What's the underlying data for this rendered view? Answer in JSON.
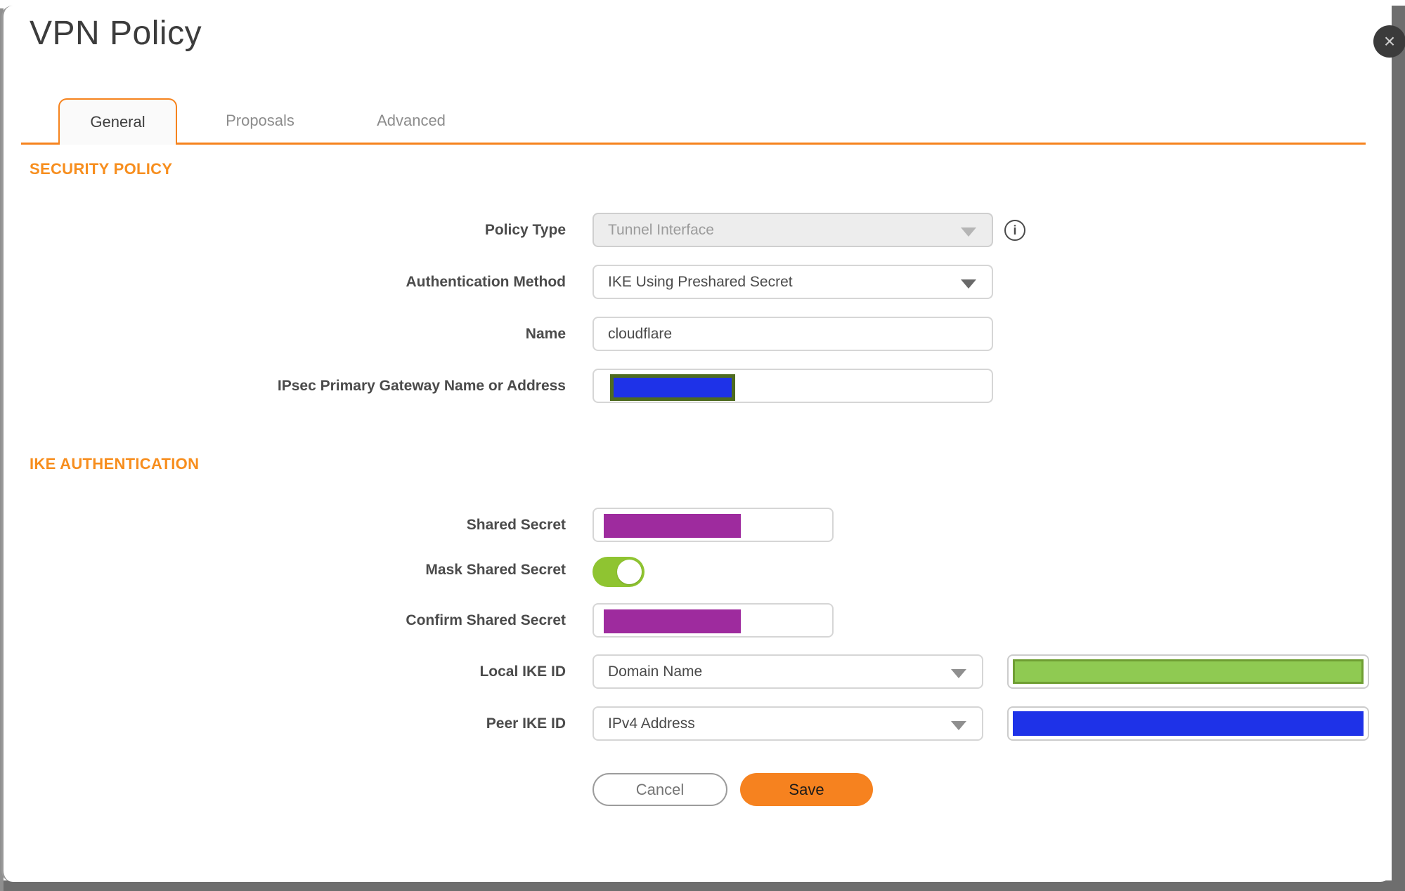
{
  "dialog": {
    "title": "VPN Policy",
    "close_label": "×"
  },
  "tabs": [
    {
      "label": "General",
      "active": true
    },
    {
      "label": "Proposals",
      "active": false
    },
    {
      "label": "Advanced",
      "active": false
    }
  ],
  "sections": {
    "security_policy": "SECURITY POLICY",
    "ike_authentication": "IKE AUTHENTICATION"
  },
  "fields": {
    "policy_type": {
      "label": "Policy Type",
      "value": "Tunnel Interface",
      "disabled": true,
      "info_icon": "info-circle",
      "info_glyph": "i"
    },
    "auth_method": {
      "label": "Authentication Method",
      "value": "IKE Using Preshared Secret"
    },
    "name": {
      "label": "Name",
      "value": "cloudflare"
    },
    "gateway": {
      "label": "IPsec Primary Gateway Name or Address",
      "value_redacted": true
    },
    "shared_secret": {
      "label": "Shared Secret",
      "value_redacted": true
    },
    "mask_shared_secret": {
      "label": "Mask Shared Secret",
      "state": "on"
    },
    "confirm_shared_secret": {
      "label": "Confirm Shared Secret",
      "value_redacted": true
    },
    "local_ike_id": {
      "label": "Local IKE ID",
      "value": "Domain Name",
      "value_redacted": true
    },
    "peer_ike_id": {
      "label": "Peer IKE ID",
      "value": "IPv4 Address",
      "value_redacted": true
    }
  },
  "buttons": {
    "cancel": "Cancel",
    "save": "Save"
  },
  "colors": {
    "accent_orange": "#F6831D",
    "section_header_orange": "#F78E1E",
    "save_button_orange": "#F6821F",
    "toggle_green": "#8FC431",
    "redaction_purple": "#9E2B9E",
    "redaction_blue": "#1E32E8",
    "redaction_green_fill": "#8FCA52",
    "redaction_green_border": "#6F9E33",
    "gateway_redaction_border_olive": "#4E6B1F",
    "close_button_bg": "#3B3B3B",
    "window_edge_gray": "#6E6E6E"
  }
}
